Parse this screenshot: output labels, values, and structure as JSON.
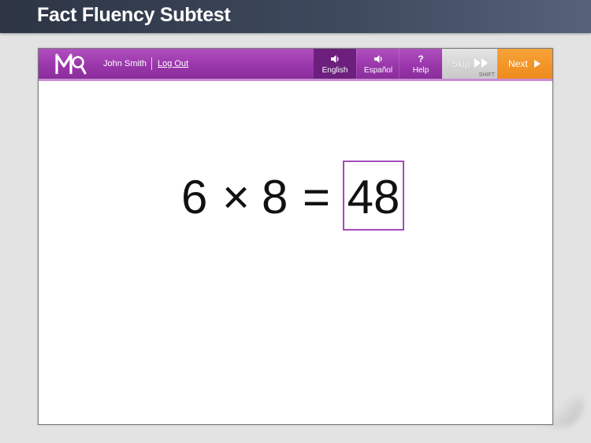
{
  "header": {
    "title": "Fact Fluency Subtest"
  },
  "toolbar": {
    "user_name": "John Smith",
    "logout_label": "Log Out",
    "english_label": "English",
    "espanol_label": "Español",
    "help_label": "Help",
    "help_glyph": "?",
    "skip_label": "Skip",
    "skip_sub": "SHIFT",
    "next_label": "Next",
    "active_language": "English"
  },
  "colors": {
    "toolbar_purple": "#9a37ab",
    "active_tab": "#6c1f7c",
    "next_orange": "#f08c1f",
    "answer_border": "#a54bbd"
  },
  "question": {
    "operand_a": "6",
    "operator": "×",
    "operand_b": "8",
    "equals": "=",
    "answer": "48"
  }
}
